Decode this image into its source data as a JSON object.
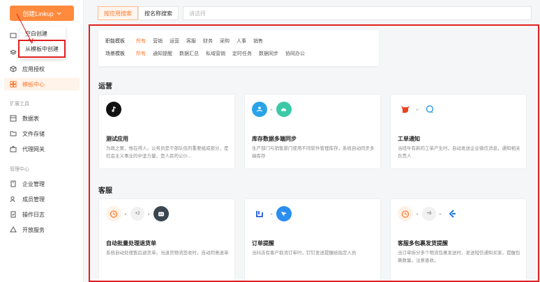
{
  "sidebar": {
    "create_button": "创建Linkup",
    "dropdown": [
      "空白创建",
      "从模板中创建"
    ],
    "items_top": [
      {
        "label": "应用授权",
        "icon": "cube-icon"
      },
      {
        "label": "模板中心",
        "icon": "template-icon",
        "active": true
      }
    ],
    "section_ext": "扩展工具",
    "items_ext": [
      {
        "label": "数据表",
        "icon": "table-icon"
      },
      {
        "label": "文件存储",
        "icon": "folder-icon"
      },
      {
        "label": "代理网关",
        "icon": "gateway-icon"
      }
    ],
    "section_mgmt": "管理中心",
    "items_mgmt": [
      {
        "label": "企业管理",
        "icon": "building-icon"
      },
      {
        "label": "成员管理",
        "icon": "members-icon"
      },
      {
        "label": "操作日志",
        "icon": "log-icon"
      },
      {
        "label": "开放服务",
        "icon": "open-service-icon"
      }
    ]
  },
  "search": {
    "tab_app": "按应用搜索",
    "tab_name": "按名称搜索",
    "placeholder": "请选择"
  },
  "filters": {
    "role_label": "职能模板",
    "role_options": [
      "所有",
      "营销",
      "运营",
      "客服",
      "财务",
      "采购",
      "人事",
      "销售"
    ],
    "scene_label": "场景模板",
    "scene_options": [
      "所有",
      "通知提醒",
      "数据汇总",
      "私域营销",
      "定时任务",
      "数据同步",
      "协同办公"
    ]
  },
  "sections": [
    {
      "title": "运营",
      "cards": [
        {
          "title": "测试应用",
          "desc": "为政之要，惟在得人。公务员是干部队伍的重要组成部分，是社会主义事业的中坚力量，是人民的公仆..."
        },
        {
          "title": "库存数据多端同步",
          "desc": "生产部门与销售部门使用不同软件管理库存，系统自动同步多端库存"
        },
        {
          "title": "工单通知",
          "desc": "当班牛有新的工单产生时，自动发送企业微信消息，通知相关负责人"
        }
      ]
    },
    {
      "title": "客服",
      "cards": [
        {
          "title": "自动批量处理退货单",
          "desc": "系统自动处理售后退货单，当退货物流签收时，自动同意退单",
          "badge": "+2"
        },
        {
          "title": "订单提醒",
          "desc": "当抖店有客户取消订单时，钉钉发送提醒给指定人员"
        },
        {
          "title": "客服多包裹发货提醒",
          "desc": "当订单拆分多个物流包裹发送时，发送短信通知买家，提醒包裹数量，注意查收。",
          "badge": "+6"
        }
      ]
    }
  ],
  "colors": {
    "accent": "#ff7a2f",
    "highlight": "#e02020"
  }
}
